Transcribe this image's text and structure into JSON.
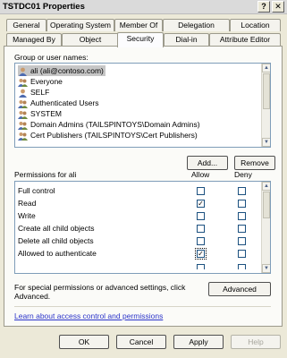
{
  "window": {
    "title": "TSTDC01 Properties",
    "help_btn": "?",
    "close_btn": "✕"
  },
  "tabs_row1": [
    "General",
    "Operating System",
    "Member Of",
    "Delegation",
    "Location"
  ],
  "tabs_row2": [
    "Managed By",
    "Object",
    "Security",
    "Dial-in",
    "Attribute Editor"
  ],
  "active_tab": "Security",
  "group_label": "Group or user names:",
  "principals": [
    {
      "name": "ali (ali@contoso.com)",
      "icon": "user-icon",
      "selected": true
    },
    {
      "name": "Everyone",
      "icon": "group-icon",
      "selected": false
    },
    {
      "name": "SELF",
      "icon": "user-icon",
      "selected": false
    },
    {
      "name": "Authenticated Users",
      "icon": "group-icon",
      "selected": false
    },
    {
      "name": "SYSTEM",
      "icon": "group-icon",
      "selected": false
    },
    {
      "name": "Domain Admins (TAILSPINTOYS\\Domain Admins)",
      "icon": "group-icon",
      "selected": false
    },
    {
      "name": "Cert Publishers (TAILSPINTOYS\\Cert Publishers)",
      "icon": "group-icon",
      "selected": false
    }
  ],
  "add_btn": "Add...",
  "remove_btn": "Remove",
  "permissions_label": "Permissions for ali",
  "allow_label": "Allow",
  "deny_label": "Deny",
  "permissions": [
    {
      "name": "Full control",
      "allow": false,
      "deny": false
    },
    {
      "name": "Read",
      "allow": true,
      "deny": false
    },
    {
      "name": "Write",
      "allow": false,
      "deny": false
    },
    {
      "name": "Create all child objects",
      "allow": false,
      "deny": false
    },
    {
      "name": "Delete all child objects",
      "allow": false,
      "deny": false
    },
    {
      "name": "Allowed to authenticate",
      "allow": true,
      "deny": false
    }
  ],
  "advanced_text_line1": "For special permissions or advanced settings, click",
  "advanced_text_line2": "Advanced.",
  "advanced_btn": "Advanced",
  "learn_link": "Learn about access control and permissions",
  "footer": {
    "ok": "OK",
    "cancel": "Cancel",
    "apply": "Apply",
    "help": "Help"
  },
  "colors": {
    "selection": "#c6c6c6",
    "link": "#2b34c9"
  }
}
